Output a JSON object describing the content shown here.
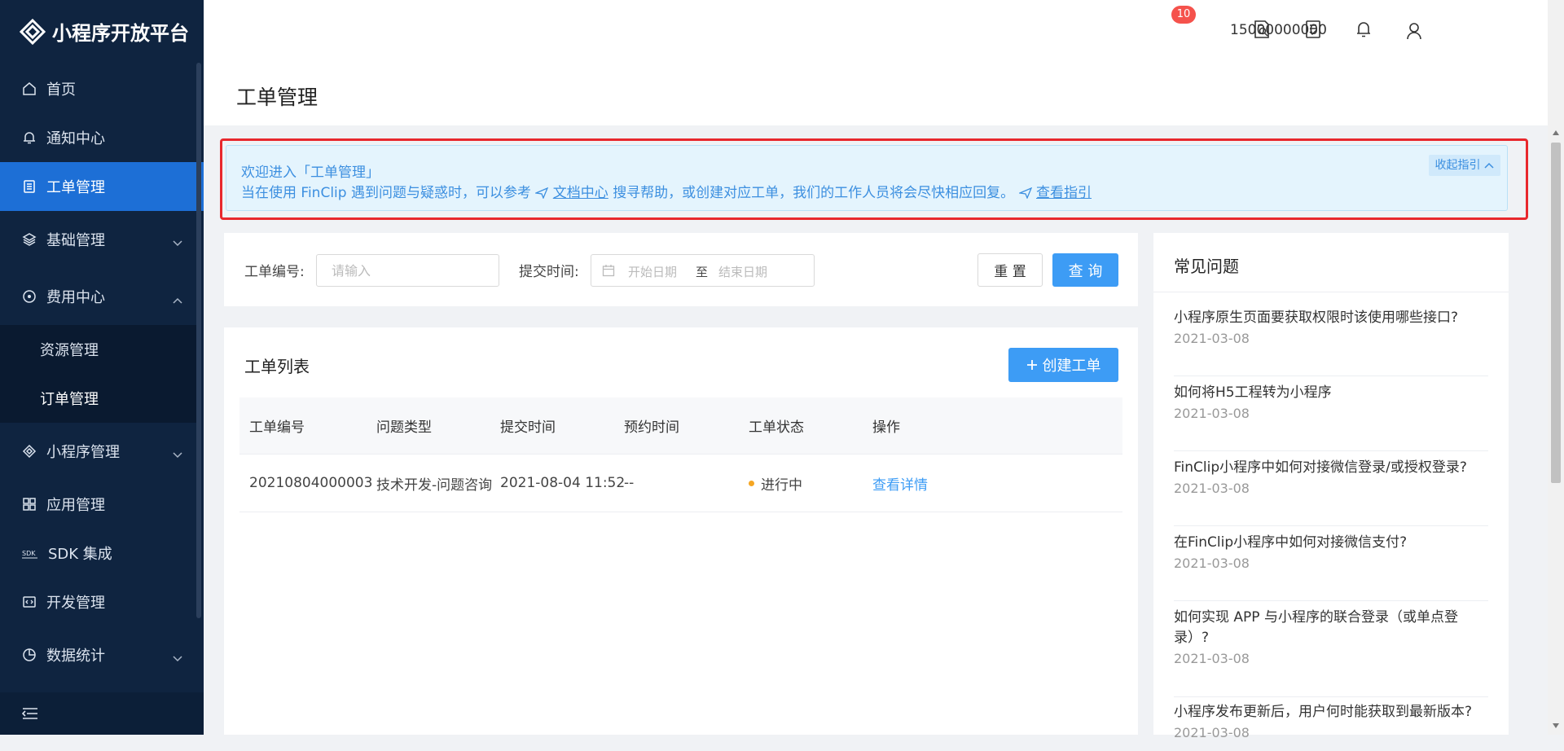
{
  "app": {
    "title": "小程序开放平台"
  },
  "sidebar": {
    "items": [
      {
        "label": "首页",
        "icon": "home-icon"
      },
      {
        "label": "通知中心",
        "icon": "bell-icon"
      },
      {
        "label": "工单管理",
        "icon": "ticket-icon",
        "active": true
      },
      {
        "label": "基础管理",
        "icon": "layers-icon"
      },
      {
        "label": "费用中心",
        "icon": "coin-icon",
        "expanded": true
      },
      {
        "label": "小程序管理",
        "icon": "diamond-icon"
      },
      {
        "label": "应用管理",
        "icon": "grid-icon"
      },
      {
        "label": "SDK 集成",
        "icon": "sdk-icon"
      },
      {
        "label": "开发管理",
        "icon": "code-icon"
      },
      {
        "label": "数据统计",
        "icon": "pie-icon"
      }
    ],
    "sub_items": [
      {
        "label": "资源管理"
      },
      {
        "label": "订单管理"
      }
    ]
  },
  "header": {
    "notification_count": "10",
    "username": "15000000000"
  },
  "page": {
    "title": "工单管理"
  },
  "notice": {
    "line1": "欢迎进入「工单管理」",
    "line2_a": "当在使用 FinClip 遇到问题与疑惑时，可以参考",
    "doc_link": "文档中心",
    "line2_b": " 搜寻帮助，或创建对应工单，我们的工作人员将会尽快相应回复。",
    "guide_link": "查看指引",
    "collapse_label": "收起指引"
  },
  "filter": {
    "id_label": "工单编号:",
    "id_placeholder": "请输入",
    "time_label": "提交时间:",
    "start_placeholder": "开始日期",
    "range_separator": "至",
    "end_placeholder": "结束日期",
    "reset_label": "重 置",
    "query_label": "查 询"
  },
  "list": {
    "title": "工单列表",
    "create_label": "创建工单",
    "columns": [
      "工单编号",
      "问题类型",
      "提交时间",
      "预约时间",
      "工单状态",
      "操作"
    ],
    "rows": [
      {
        "id": "20210804000003",
        "type": "技术开发-问题咨询",
        "submitted": "2021-08-04 11:52",
        "scheduled": "--",
        "status": "进行中",
        "action": "查看详情"
      }
    ]
  },
  "faq": {
    "title": "常见问题",
    "items": [
      {
        "q": "小程序原生页面要获取权限时该使用哪些接口?",
        "date": "2021-03-08"
      },
      {
        "q": "如何将H5工程转为小程序",
        "date": "2021-03-08"
      },
      {
        "q": "FinClip小程序中如何对接微信登录/或授权登录?",
        "date": "2021-03-08"
      },
      {
        "q": "在FinClip小程序中如何对接微信支付?",
        "date": "2021-03-08"
      },
      {
        "q": "如何实现 APP 与小程序的联合登录（或单点登录）?",
        "date": "2021-03-08"
      },
      {
        "q": "小程序发布更新后，用户何时能获取到最新版本?",
        "date": "2021-03-08"
      }
    ]
  },
  "colors": {
    "sidebar_bg": "#0f2440",
    "active": "#1d6fd6",
    "primary": "#3d9cf5",
    "status_dot": "#f5a623",
    "badge": "#f5524c"
  }
}
